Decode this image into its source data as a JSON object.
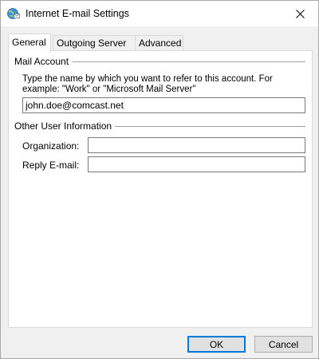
{
  "window": {
    "title": "Internet E-mail Settings",
    "icon": "globe-envelope-icon",
    "close_icon": "close-icon"
  },
  "tabs": [
    {
      "label": "General",
      "active": true
    },
    {
      "label": "Outgoing Server",
      "active": false
    },
    {
      "label": "Advanced",
      "active": false
    }
  ],
  "general": {
    "mail_account": {
      "heading": "Mail Account",
      "instruction": "Type the name by which you want to refer to this account. For example: \"Work\" or \"Microsoft Mail Server\"",
      "account_name_value": "john.doe@comcast.net"
    },
    "other_info": {
      "heading": "Other User Information",
      "organization_label": "Organization:",
      "organization_value": "",
      "reply_label": "Reply E-mail:",
      "reply_value": ""
    }
  },
  "buttons": {
    "ok": "OK",
    "cancel": "Cancel"
  },
  "colors": {
    "accent": "#0078d7",
    "panel_bg": "#ffffff",
    "dialog_bg": "#f0f0f0"
  }
}
